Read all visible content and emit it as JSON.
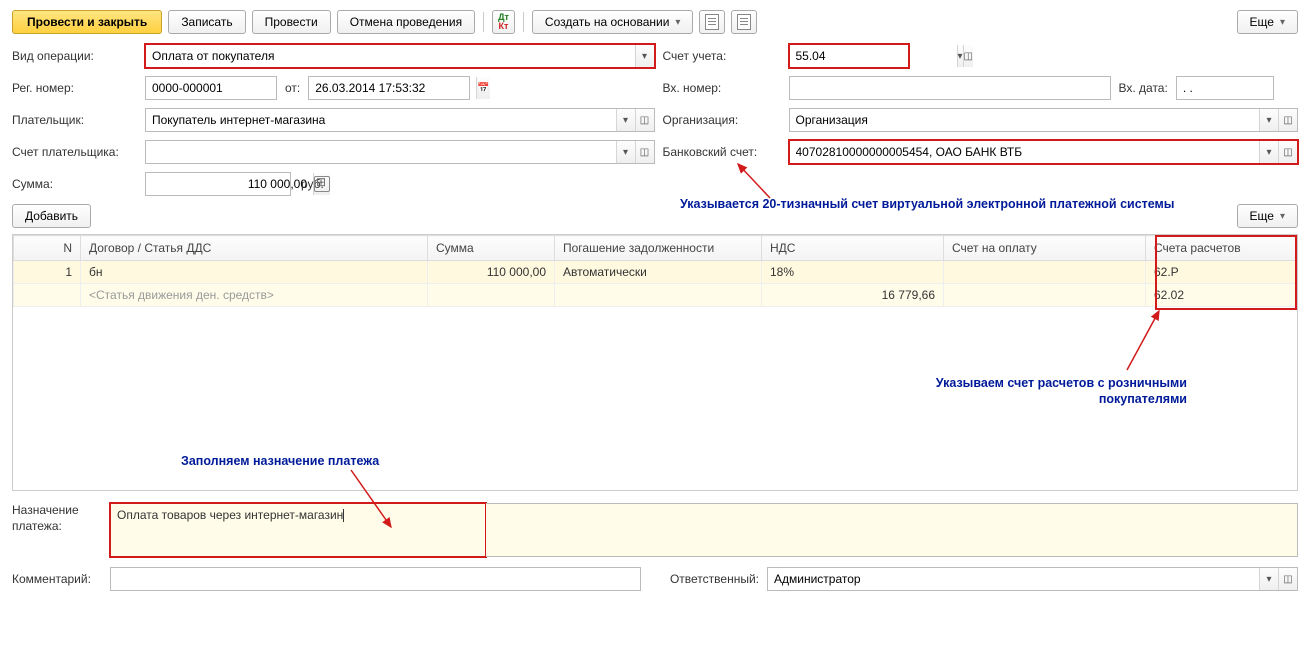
{
  "toolbar": {
    "post_close": "Провести и закрыть",
    "save": "Записать",
    "post": "Провести",
    "cancel_post": "Отмена проведения",
    "create_based": "Создать на основании",
    "more": "Еще"
  },
  "labels": {
    "op_type": "Вид операции:",
    "account": "Счет учета:",
    "reg_num": "Рег. номер:",
    "from": "от:",
    "in_num": "Вх. номер:",
    "in_date": "Вх. дата:",
    "payer": "Плательщик:",
    "org": "Организация:",
    "payer_acc": "Счет плательщика:",
    "bank_acc": "Банковский счет:",
    "sum": "Сумма:",
    "rub": "руб.",
    "add": "Добавить",
    "purpose": "Назначение платежа:",
    "comment": "Комментарий:",
    "responsible": "Ответственный:"
  },
  "fields": {
    "op_type": "Оплата от покупателя",
    "account": "55.04",
    "reg_num": "0000-000001",
    "reg_date": "26.03.2014 17:53:32",
    "in_num": "",
    "in_date": ". .",
    "payer": "Покупатель интернет-магазина",
    "org": "Организация",
    "payer_acc": "",
    "bank_acc": "40702810000000005454, ОАО БАНК ВТБ",
    "sum": "110 000,00",
    "purpose": "Оплата товаров через интернет-магазин",
    "comment": "",
    "responsible": "Администратор"
  },
  "table": {
    "headers": {
      "n": "N",
      "contract": "Договор / Статья ДДС",
      "sum": "Сумма",
      "repay": "Погашение задолженности",
      "vat": "НДС",
      "invoice": "Счет на оплату",
      "accounts": "Счета расчетов"
    },
    "r1": {
      "n": "1",
      "contract": "бн",
      "sum": "110 000,00",
      "repay": "Автоматически",
      "vat": "18%",
      "acc": "62.Р"
    },
    "r2": {
      "contract": "<Статья движения ден. средств>",
      "vat": "16 779,66",
      "acc": "62.02"
    }
  },
  "annotations": {
    "bank": "Указывается 20-тизначный счет виртуальной электронной платежной системы",
    "accounts": "Указываем счет расчетов с розничными покупателями",
    "purpose": "Заполняем назначение платежа"
  }
}
